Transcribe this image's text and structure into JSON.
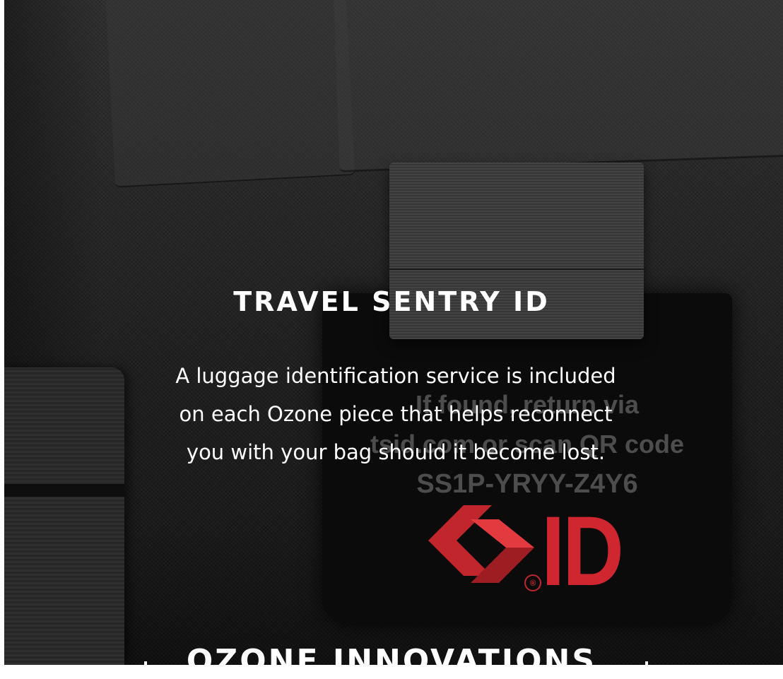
{
  "hero": {
    "title": "TRAVEL SENTRY ID",
    "description_lines": [
      "A luggage identification service is included",
      "on each Ozone piece that helps reconnect",
      "you with your bag should it become lost."
    ]
  },
  "tag": {
    "lines": [
      "If found, return via",
      "tsid.com or scan QR code",
      "SS1P-YRYY-Z4Y6"
    ],
    "logo_text": "ID",
    "registered_mark": "®",
    "brand_color": "#d0262f"
  },
  "next_section": {
    "title": "OZONE INNOVATIONS"
  }
}
